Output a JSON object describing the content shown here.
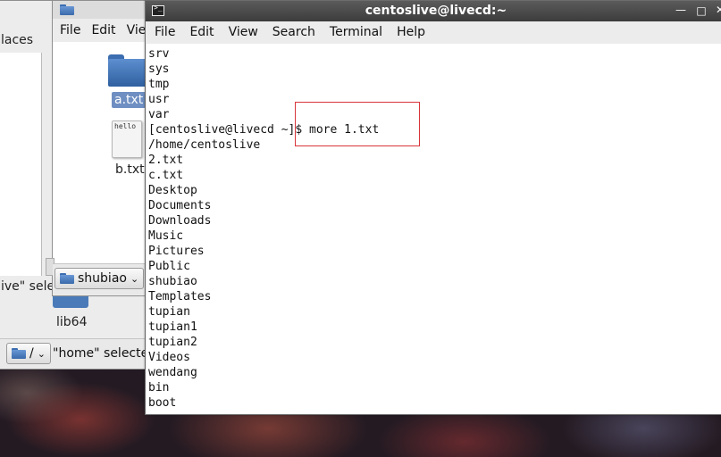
{
  "back_window": {
    "places_label": "laces",
    "selection_text": "ive\" sele",
    "lib_label": "lib64",
    "path_button": "/",
    "status": "\"home\" selected"
  },
  "file_window": {
    "menus": [
      "File",
      "Edit",
      "Vie"
    ],
    "files": [
      {
        "name": "a.txt",
        "selected": true
      },
      {
        "name": "b.txt",
        "preview": "hello"
      }
    ],
    "path_button": "shubiao"
  },
  "terminal": {
    "title": "centoslive@livecd:~",
    "menus": [
      "File",
      "Edit",
      "View",
      "Search",
      "Terminal",
      "Help"
    ],
    "controls": [
      "minimize",
      "maximize",
      "close"
    ],
    "lines": [
      "srv",
      "sys",
      "tmp",
      "usr",
      "var",
      "[centoslive@livecd ~]$ more 1.txt",
      "/home/centoslive",
      "2.txt",
      "c.txt",
      "Desktop",
      "Documents",
      "Downloads",
      "Music",
      "Pictures",
      "Public",
      "shubiao",
      "Templates",
      "tupian",
      "tupian1",
      "tupian2",
      "Videos",
      "wendang",
      "bin",
      "boot"
    ],
    "highlight_color": "#d9353b"
  }
}
